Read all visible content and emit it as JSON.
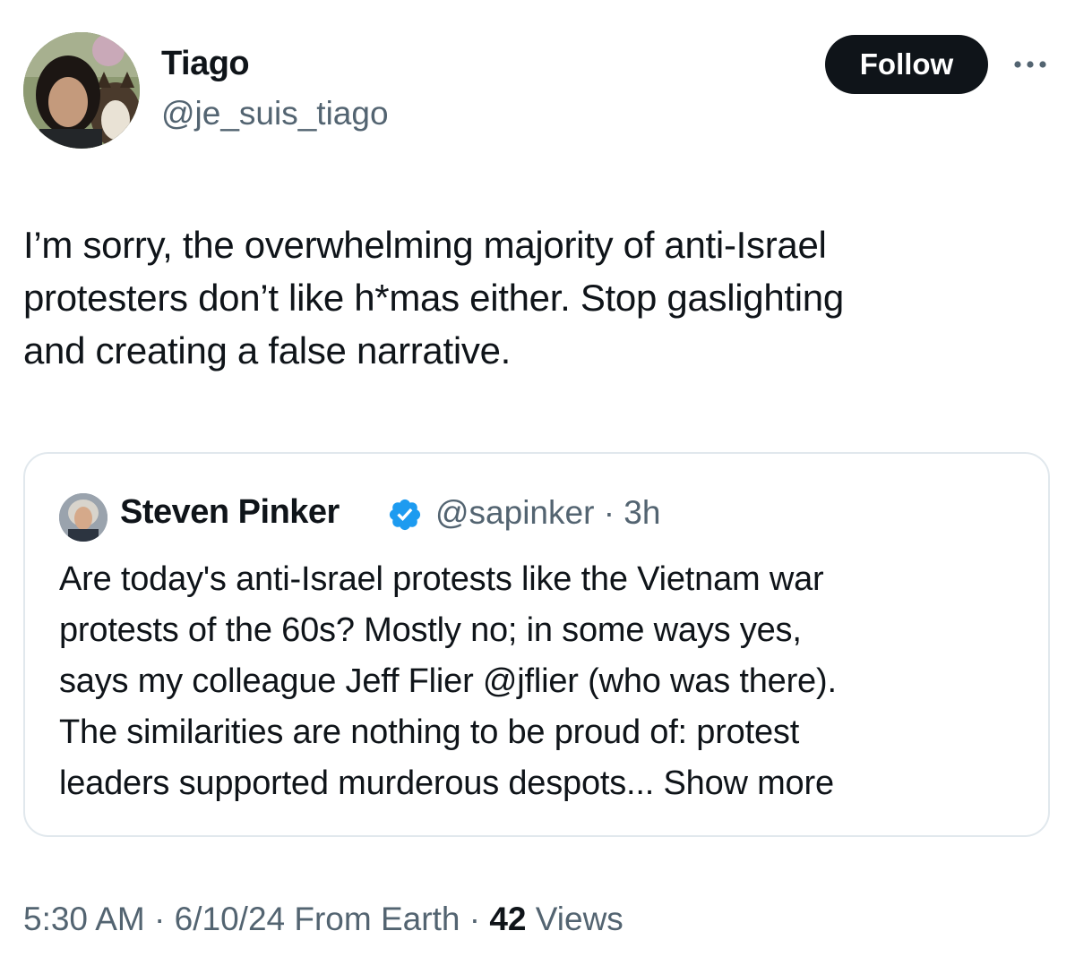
{
  "author": {
    "name": "Tiago",
    "handle": "@je_suis_tiago"
  },
  "actions": {
    "follow_label": "Follow",
    "more_icon": "more-dots-icon"
  },
  "tweet": {
    "text_lines": [
      "I’m sorry, the overwhelming majority of anti-Israel",
      "protesters don’t like h*mas either. Stop gaslighting",
      "and creating a false narrative."
    ]
  },
  "quote": {
    "name": "Steven Pinker",
    "verified_icon": "verified-badge-icon",
    "verified_color": "#1d9bf0",
    "handle_time": "@sapinker · 3h",
    "text_lines": [
      "Are today's anti-Israel protests like the Vietnam war",
      "protests of the 60s?  Mostly no; in some ways yes,",
      "says my colleague Jeff Flier @jflier (who was there).",
      "The similarities are nothing to be proud of:  protest",
      "leaders supported murderous despots..."
    ],
    "show_more": "Show more"
  },
  "meta": {
    "time": "5:30 AM",
    "sep1": " · ",
    "date": "6/10/24",
    "source": " From Earth",
    "sep2": " · ",
    "views_count": "42",
    "views_label": " Views"
  }
}
